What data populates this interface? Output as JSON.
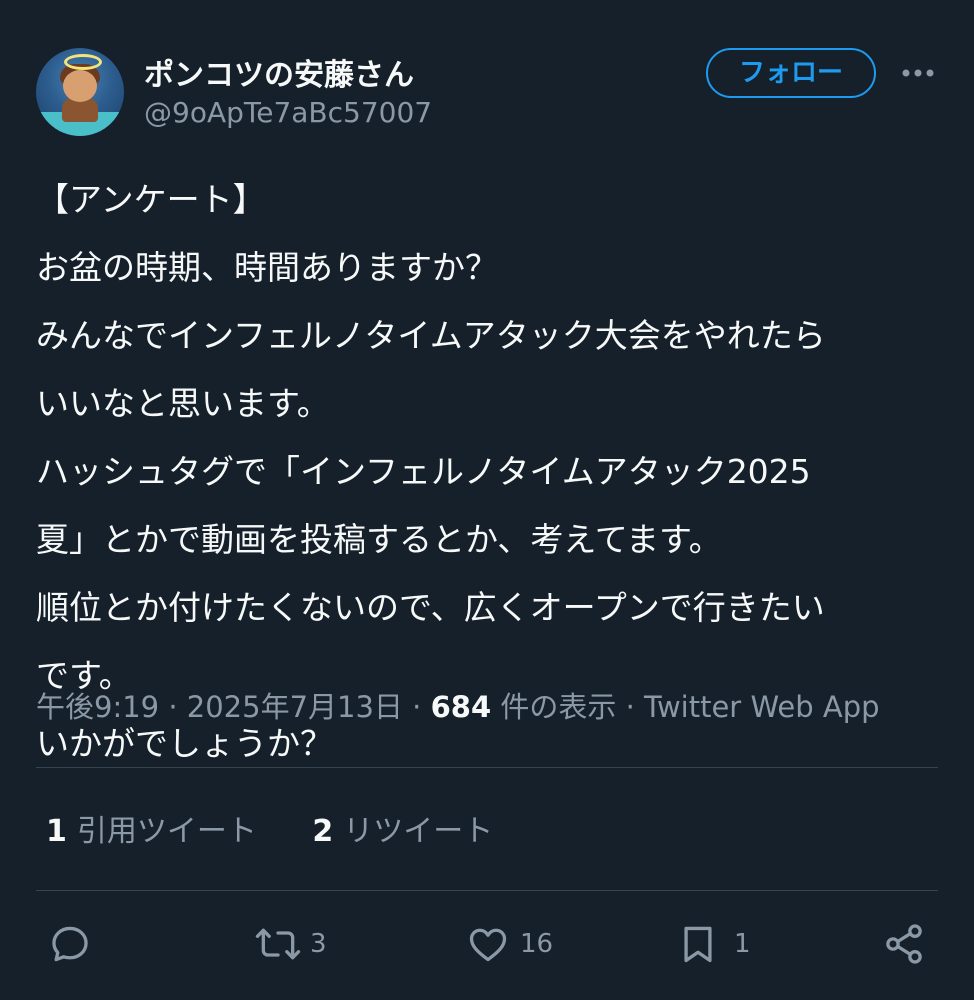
{
  "header": {
    "display_name": "ポンコツの安藤さん",
    "handle": "@9oApTe7aBc57007",
    "follow_label": "フォロー"
  },
  "tweet": {
    "lines": [
      "【アンケート】",
      "お盆の時期、時間ありますか？",
      "みんなでインフェルノタイムアタック大会をやれたら",
      "いいなと思います。",
      "ハッシュタグで「インフェルノタイムアタック2025",
      "夏」とかで動画を投稿するとか、考えてます。",
      "順位とか付けたくないので、広くオープンで行きたい",
      "です。",
      "いかがでしょうか？"
    ]
  },
  "meta": {
    "time": "午後9:19",
    "date": "2025年7月13日",
    "views_count": "684",
    "views_label": "件の表示",
    "source": "Twitter Web App",
    "separator": "·"
  },
  "stats": {
    "quotes_count": "1",
    "quotes_label": "引用ツイート",
    "retweets_count": "2",
    "retweets_label": "リツイート"
  },
  "actions": {
    "reply_count": "",
    "retweet_count": "3",
    "like_count": "16",
    "bookmark_count": "1"
  },
  "icons": {
    "more": "more-icon",
    "reply": "reply-icon",
    "retweet": "retweet-icon",
    "like": "heart-icon",
    "bookmark": "bookmark-icon",
    "share": "share-icon"
  },
  "colors": {
    "background": "#15202b",
    "accent": "#1d9bf0",
    "secondary_text": "#8b98a5",
    "divider": "#38444d"
  }
}
